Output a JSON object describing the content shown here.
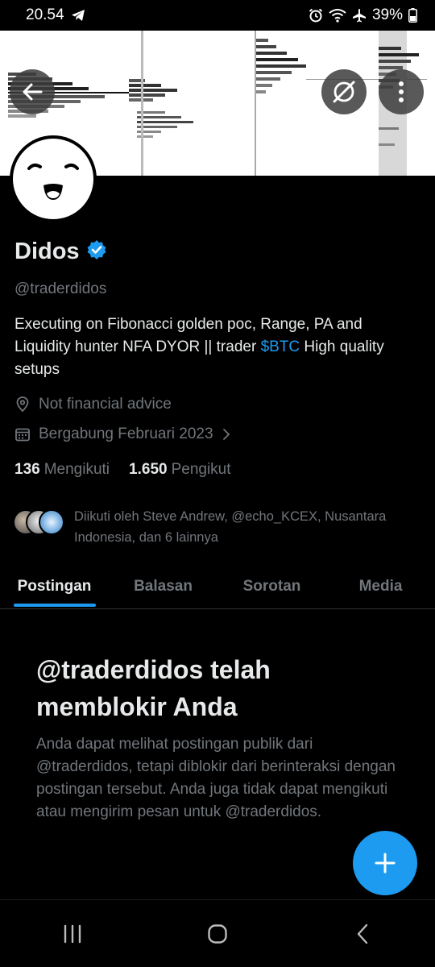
{
  "status_bar": {
    "time": "20.54",
    "battery": "39%",
    "icons": [
      "telegram-icon",
      "alarm-icon",
      "wifi-icon",
      "airplane-icon",
      "battery-icon"
    ]
  },
  "header": {
    "back_icon": "arrow-left-icon",
    "grok_icon": "grok-icon",
    "more_icon": "more-vertical-icon"
  },
  "profile": {
    "display_name": "Didos",
    "verified": true,
    "handle": "@traderdidos",
    "bio_part1": "Executing on Fibonacci golden poc, Range, PA and Liquidity hunter NFA DYOR || trader ",
    "bio_cashtag": "$BTC",
    "bio_part2": " High quality setups",
    "location": "Not financial advice",
    "joined": "Bergabung Februari 2023",
    "following_count": "136",
    "following_label": "Mengikuti",
    "followers_count": "1.650",
    "followers_label": "Pengikut",
    "followed_by": "Diikuti oleh Steve Andrew, @echo_KCEX, Nusantara Indonesia, dan 6 lainnya"
  },
  "tabs": [
    {
      "label": "Postingan",
      "active": true
    },
    {
      "label": "Balasan",
      "active": false
    },
    {
      "label": "Sorotan",
      "active": false
    },
    {
      "label": "Media",
      "active": false
    }
  ],
  "blocked": {
    "title": "@traderdidos telah memblokir Anda",
    "description": "Anda dapat melihat postingan publik dari @traderdidos, tetapi diblokir dari berinteraksi dengan postingan tersebut. Anda juga tidak dapat mengikuti atau mengirim pesan untuk @traderdidos."
  },
  "fab_icon": "plus-icon",
  "nav": [
    "recents-icon",
    "home-icon",
    "back-icon"
  ],
  "colors": {
    "accent": "#1d9bf0",
    "background": "#000000",
    "text_primary": "#e7e9ea",
    "text_secondary": "#71767b"
  }
}
